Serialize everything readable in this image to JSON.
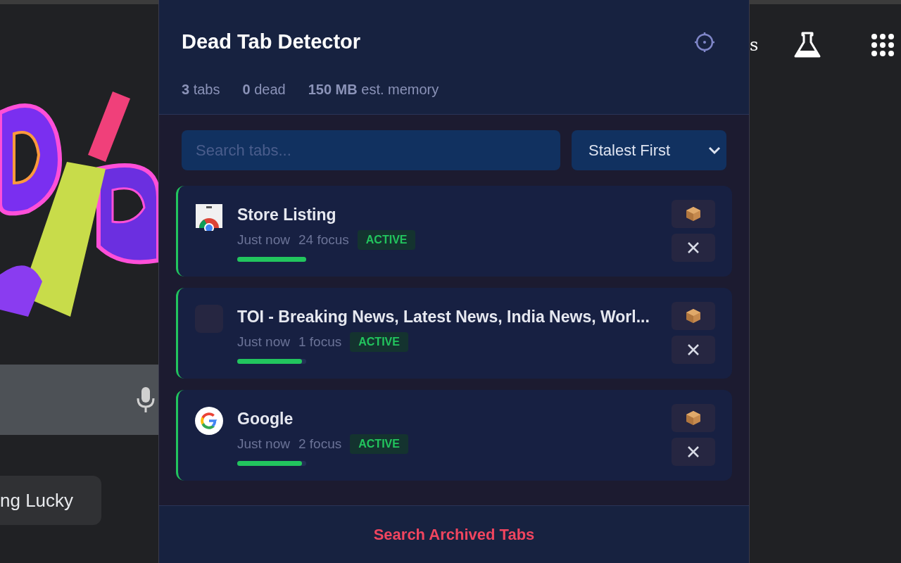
{
  "background": {
    "search_button": "ng Lucky",
    "right_text": "s"
  },
  "popup": {
    "title": "Dead Tab Detector",
    "stats": [
      "**3** tabs",
      "**0** dead",
      "**150 MB** est. memory"
    ],
    "search": {
      "placeholder": "Search tabs..."
    },
    "sort": {
      "value": "Stalest First"
    },
    "tabs": [
      {
        "title": "Store Listing",
        "kind": "store",
        "time": "Just now",
        "focus": "24 focus",
        "status": "ACTIVE",
        "level": 1.0
      },
      {
        "title": "TOI - Breaking News, Latest News, India News, Worl...",
        "kind": "blank",
        "time": "Just now",
        "focus": "1 focus",
        "status": "ACTIVE",
        "level": 0.94
      },
      {
        "title": "Google",
        "kind": "google",
        "time": "Just now",
        "focus": "2 focus",
        "status": "ACTIVE",
        "level": 0.94
      }
    ],
    "footer_link": "Search Archived Tabs"
  }
}
